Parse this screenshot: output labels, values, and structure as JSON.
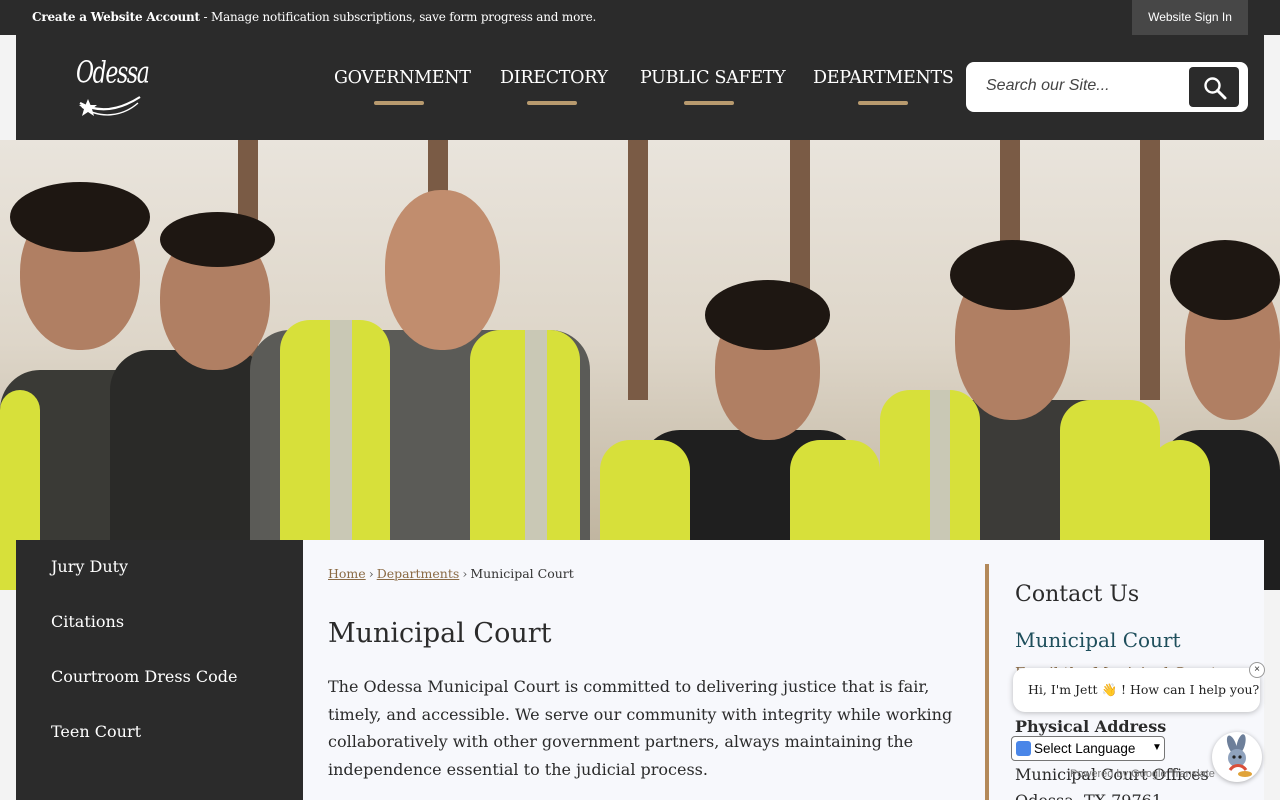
{
  "topbar": {
    "account_link": "Create a Website Account",
    "account_desc": " - Manage notification subscriptions, save form progress and more.",
    "signin_label": "Website Sign In"
  },
  "header": {
    "logo_text": "Odessa",
    "nav": [
      {
        "label": "GOVERNMENT"
      },
      {
        "label": "DIRECTORY"
      },
      {
        "label": "PUBLIC SAFETY"
      },
      {
        "label": "DEPARTMENTS"
      }
    ],
    "search": {
      "placeholder": "Search our Site..."
    }
  },
  "hero": {
    "icon": "hero-photo"
  },
  "sidebar": {
    "items": [
      {
        "label": "Jury Duty"
      },
      {
        "label": "Citations"
      },
      {
        "label": "Courtroom Dress Code"
      },
      {
        "label": "Teen Court"
      }
    ]
  },
  "breadcrumb": {
    "home": "Home",
    "departments": "Departments",
    "current": "Municipal Court"
  },
  "main": {
    "title": "Municipal Court",
    "lead": "The Odessa Municipal Court is committed to delivering justice that is fair, timely, and accessible. We serve our community with integrity while working collaboratively with other government partners, always maintaining the independence essential to the judicial process."
  },
  "contact": {
    "heading": "Contact Us",
    "department": "Municipal Court",
    "email_link": "Email the Municipal Court",
    "physical_heading": "Physical Address",
    "address_line1": "Municipal Court Offices",
    "address_line2": "Odessa, TX 79761"
  },
  "chat": {
    "message": "Hi, I'm Jett 👋 ! How can I help you?",
    "close": "×"
  },
  "translate": {
    "select_label": "Select Language",
    "powered_by": "Powered by Google Translate"
  },
  "colors": {
    "dark": "#2b2b2b",
    "accent": "#b89a6e",
    "link": "#8a6a44",
    "teal": "#1f4f5c"
  }
}
